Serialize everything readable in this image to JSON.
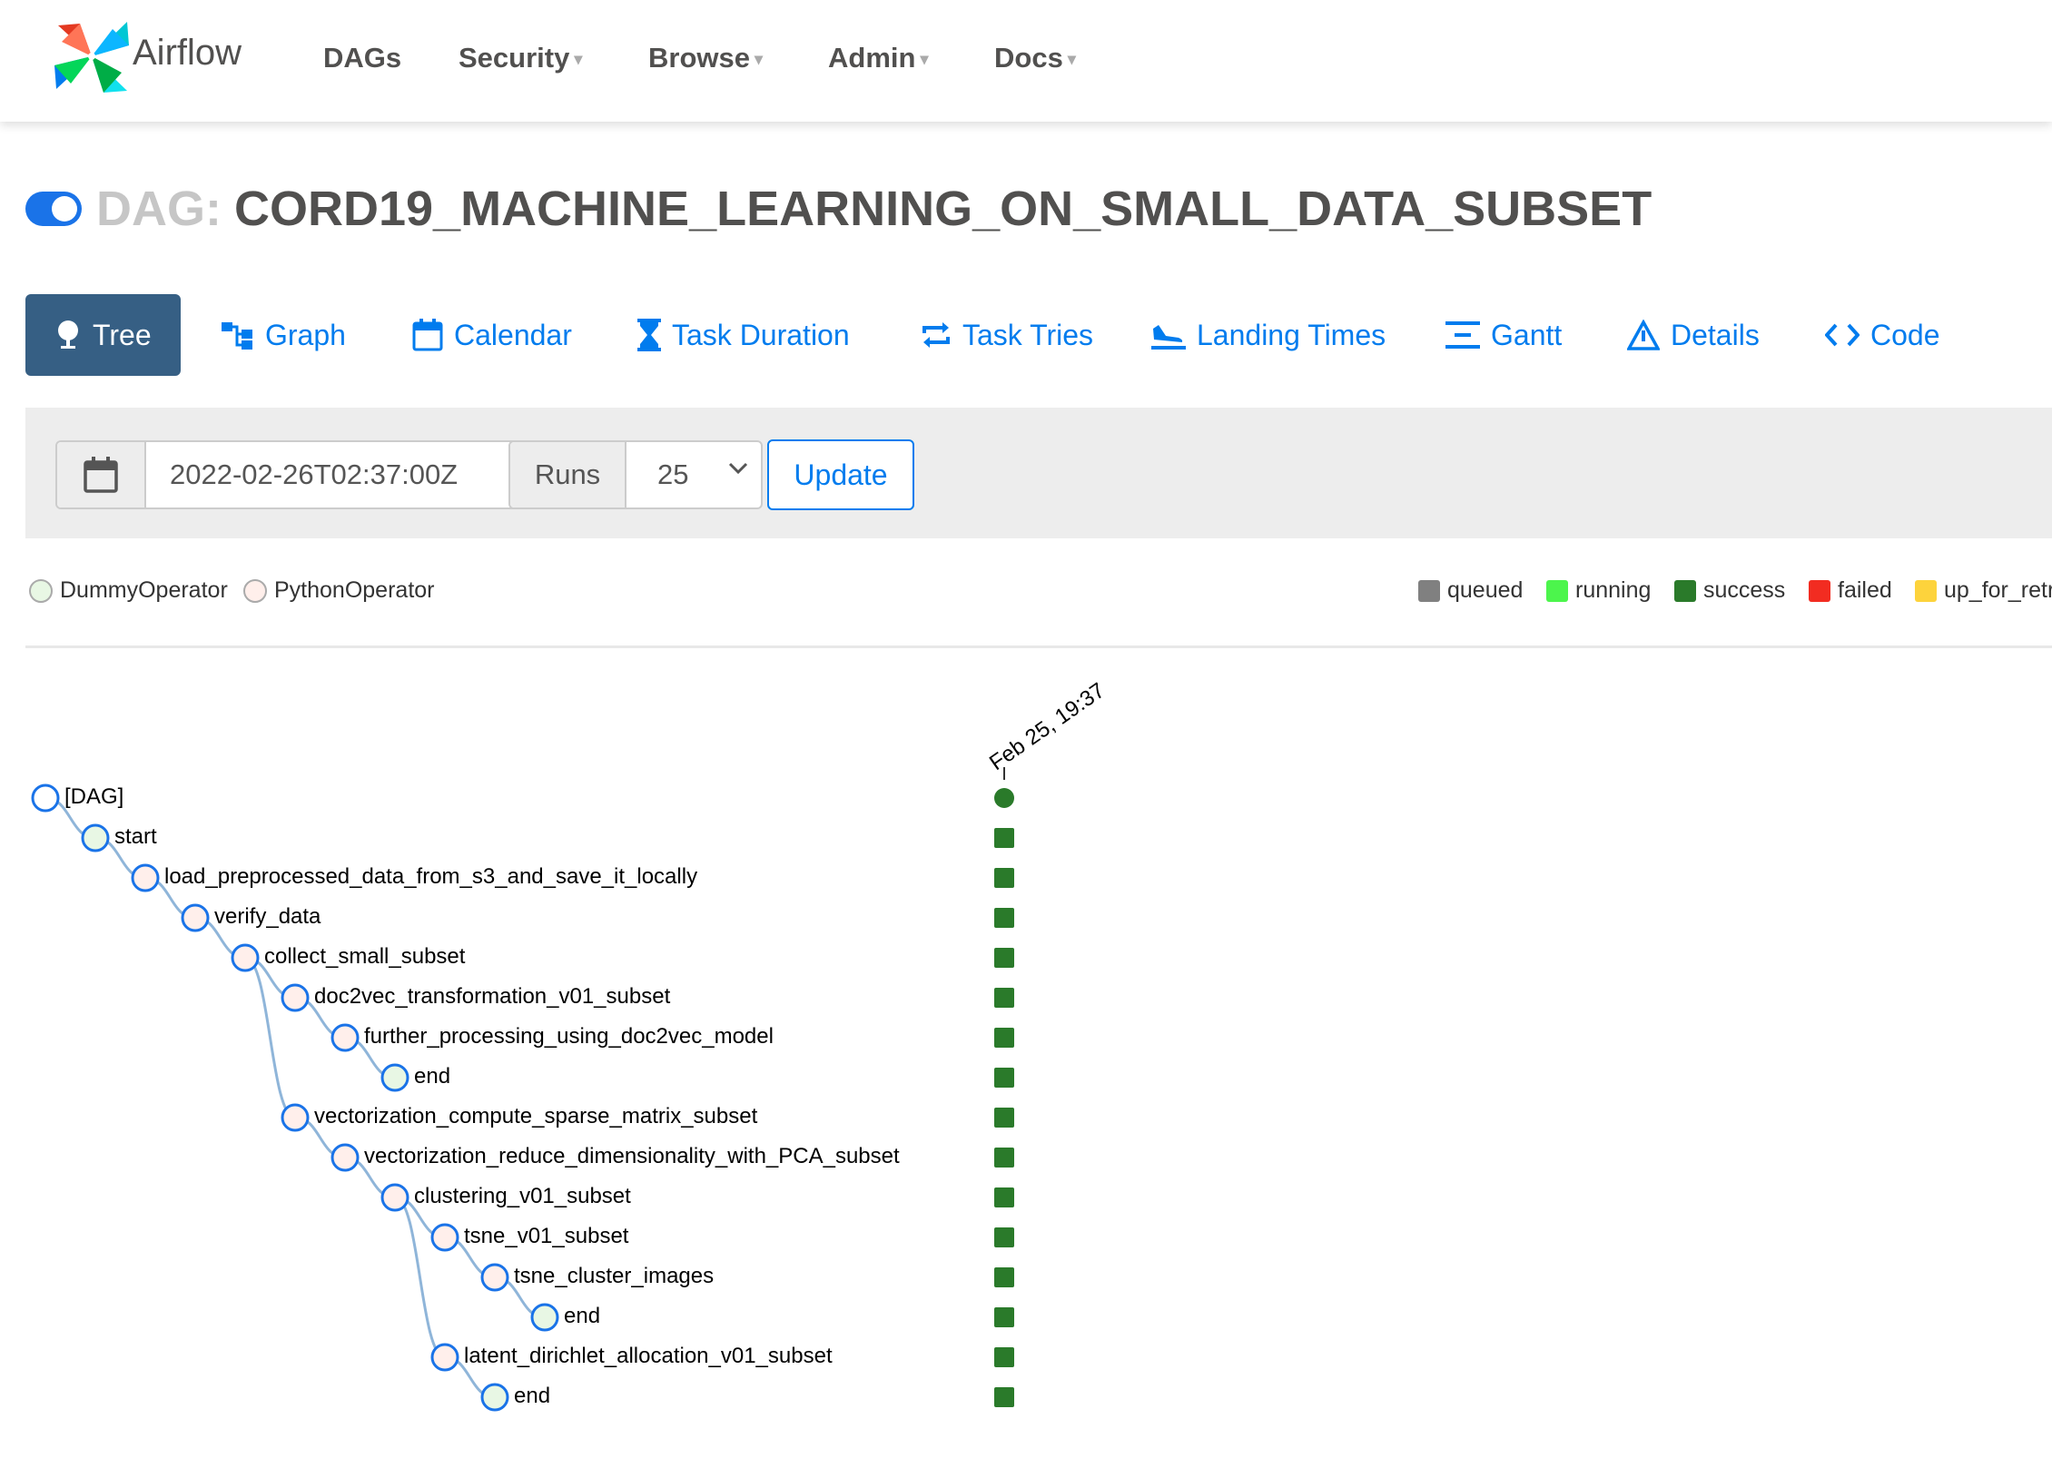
{
  "header": {
    "brand": "Airflow",
    "nav": [
      {
        "label": "DAGs",
        "dropdown": false
      },
      {
        "label": "Security",
        "dropdown": true
      },
      {
        "label": "Browse",
        "dropdown": true
      },
      {
        "label": "Admin",
        "dropdown": true
      },
      {
        "label": "Docs",
        "dropdown": true
      }
    ]
  },
  "dag": {
    "prefix": "DAG:",
    "name": "CORD19_MACHINE_LEARNING_ON_SMALL_DATA_SUBSET",
    "toggle_on": true
  },
  "tabs": [
    {
      "label": "Tree",
      "icon": "tree-icon",
      "active": true
    },
    {
      "label": "Graph",
      "icon": "graph-icon"
    },
    {
      "label": "Calendar",
      "icon": "calendar-icon"
    },
    {
      "label": "Task Duration",
      "icon": "hourglass-icon"
    },
    {
      "label": "Task Tries",
      "icon": "repeat-icon"
    },
    {
      "label": "Landing Times",
      "icon": "plane-landing-icon"
    },
    {
      "label": "Gantt",
      "icon": "gantt-icon"
    },
    {
      "label": "Details",
      "icon": "warning-triangle-icon"
    },
    {
      "label": "Code",
      "icon": "code-icon"
    }
  ],
  "filter": {
    "base_date": "2022-02-26T02:37:00Z",
    "runs_label": "Runs",
    "runs_value": "25",
    "update_label": "Update"
  },
  "legend": {
    "operators": [
      {
        "label": "DummyOperator",
        "color": "#e8f7e4"
      },
      {
        "label": "PythonOperator",
        "color": "#ffefeb"
      }
    ],
    "states": [
      {
        "label": "queued",
        "color": "#808080"
      },
      {
        "label": "running",
        "color": "#4cf54c"
      },
      {
        "label": "success",
        "color": "#2a7a2a"
      },
      {
        "label": "failed",
        "color": "#f22c21"
      },
      {
        "label": "up_for_retr",
        "color": "#fdd33c"
      }
    ]
  },
  "run_column": {
    "label": "Feb 25, 19:37"
  },
  "tree": [
    {
      "label": "[DAG]",
      "depth": 0,
      "type": "dag",
      "state": "success"
    },
    {
      "label": "start",
      "depth": 1,
      "type": "dummy",
      "state": "success"
    },
    {
      "label": "load_preprocessed_data_from_s3_and_save_it_locally",
      "depth": 2,
      "type": "python",
      "state": "success"
    },
    {
      "label": "verify_data",
      "depth": 3,
      "type": "python",
      "state": "success"
    },
    {
      "label": "collect_small_subset",
      "depth": 4,
      "type": "python",
      "state": "success"
    },
    {
      "label": "doc2vec_transformation_v01_subset",
      "depth": 5,
      "type": "python",
      "state": "success"
    },
    {
      "label": "further_processing_using_doc2vec_model",
      "depth": 6,
      "type": "python",
      "state": "success"
    },
    {
      "label": "end",
      "depth": 7,
      "type": "dummy",
      "state": "success"
    },
    {
      "label": "vectorization_compute_sparse_matrix_subset",
      "depth": 5,
      "type": "python",
      "state": "success"
    },
    {
      "label": "vectorization_reduce_dimensionality_with_PCA_subset",
      "depth": 6,
      "type": "python",
      "state": "success"
    },
    {
      "label": "clustering_v01_subset",
      "depth": 7,
      "type": "python",
      "state": "success"
    },
    {
      "label": "tsne_v01_subset",
      "depth": 8,
      "type": "python",
      "state": "success"
    },
    {
      "label": "tsne_cluster_images",
      "depth": 9,
      "type": "python",
      "state": "success"
    },
    {
      "label": "end",
      "depth": 10,
      "type": "dummy",
      "state": "success"
    },
    {
      "label": "latent_dirichlet_allocation_v01_subset",
      "depth": 8,
      "type": "python",
      "state": "success"
    },
    {
      "label": "end",
      "depth": 9,
      "type": "dummy",
      "state": "success"
    }
  ]
}
